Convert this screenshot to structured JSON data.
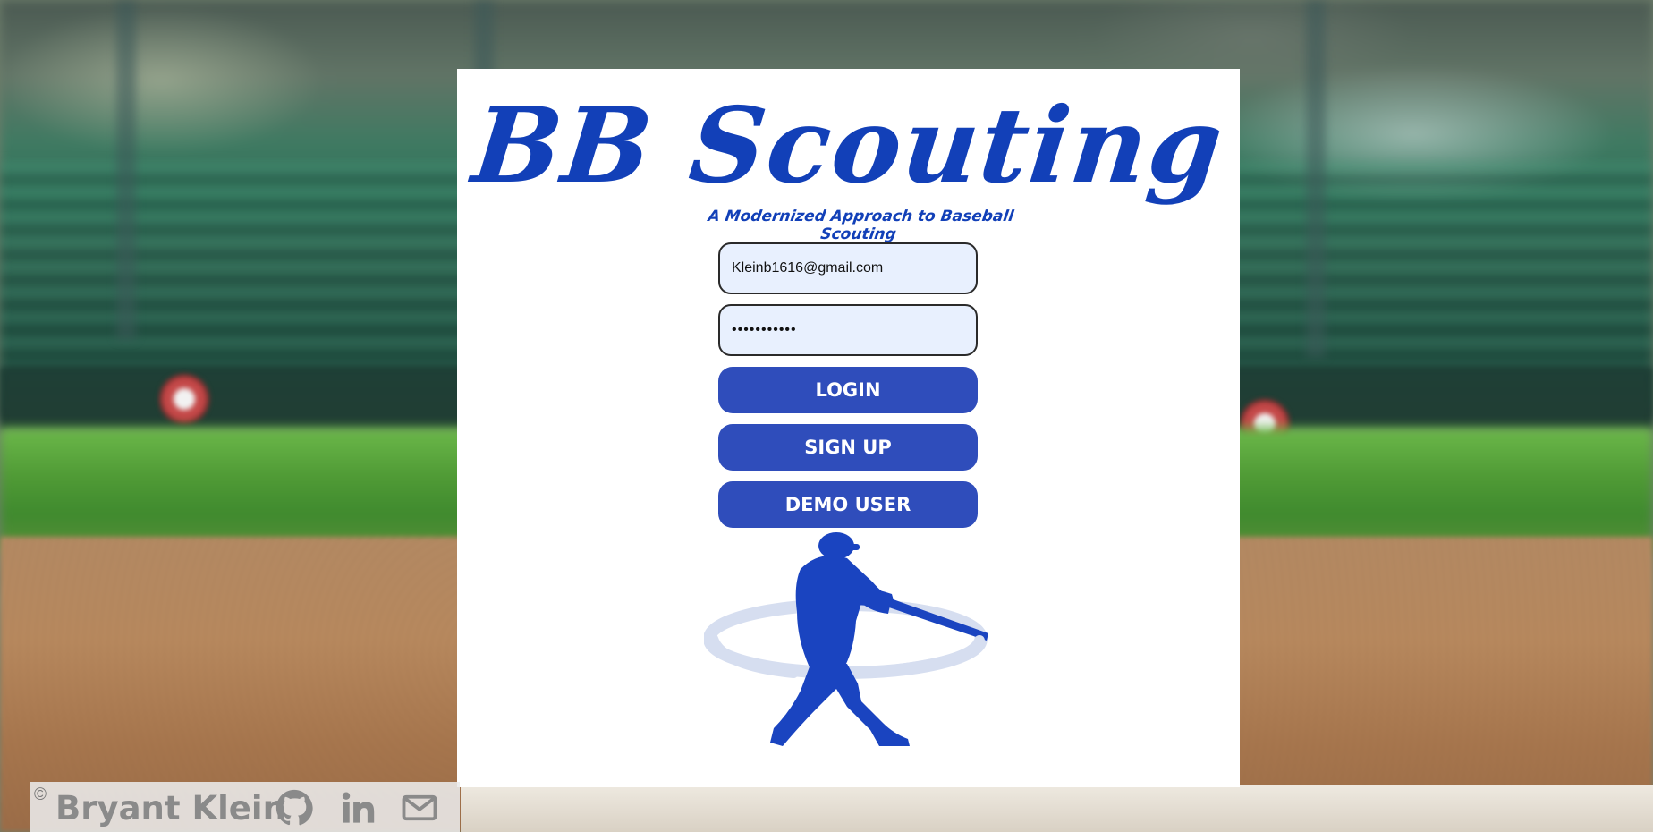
{
  "app": {
    "title": "BB Scouting",
    "subtitle": "A Modernized Approach to Baseball Scouting"
  },
  "login_form": {
    "email_value": "Kleinb1616@gmail.com",
    "password_value": "•••••••••••",
    "login_label": "LOGIN",
    "signup_label": "SIGN UP",
    "demo_label": "DEMO USER"
  },
  "footer": {
    "copyright_symbol": "©",
    "author": "Bryant Klein",
    "icons": [
      "github-icon",
      "linkedin-icon",
      "mail-icon"
    ]
  },
  "colors": {
    "brand_blue": "#1240b8",
    "button_blue": "#2f4dbb",
    "input_bg": "#e8f0fe"
  }
}
